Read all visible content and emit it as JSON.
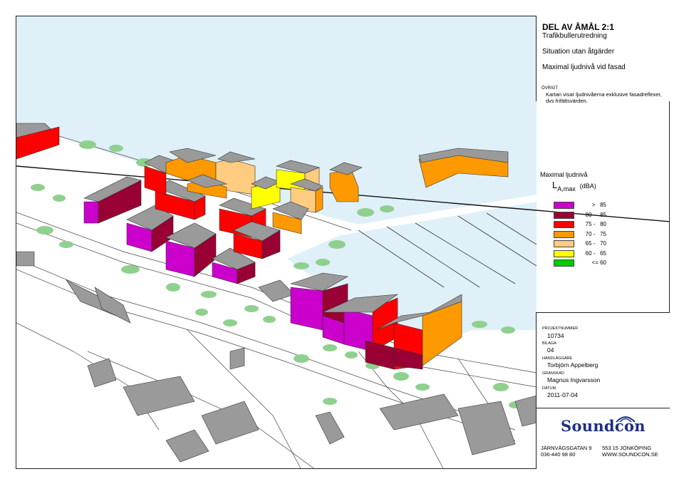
{
  "title": {
    "main": "DEL AV ÅMÅL 2:1",
    "subtitle": "Trafikbullerutredning",
    "situation": "Situation utan åtgärder",
    "measure": "Maximal ljudnivå vid fasad"
  },
  "ovrigt": {
    "label": "ÖVRIGT",
    "text_line1": "Kartan visar ljudnivåerna exklusive fasadreflexer,",
    "text_line2": "dvs frifältsvärden."
  },
  "legend": {
    "title": "Maximal ljudnivå",
    "unit_symbol": "L",
    "unit_sub": "A,max",
    "unit": "(dBA)",
    "items": [
      {
        "label": ">   85",
        "color": "#cc00cc"
      },
      {
        "label": "80 -   85",
        "color": "#990033"
      },
      {
        "label": "75 -   80",
        "color": "#ff0000"
      },
      {
        "label": "70 -   75",
        "color": "#ff9900"
      },
      {
        "label": "65 -   70",
        "color": "#ffcc80"
      },
      {
        "label": "60 -   65",
        "color": "#ffff00"
      },
      {
        "label": "<= 60",
        "color": "#00cc00"
      }
    ]
  },
  "info": {
    "projektnummer_label": "PROJEKTNUMMER",
    "projektnummer": "10734",
    "bilaga_label": "BILAGA",
    "bilaga": "04",
    "handlaggare_label": "HANDLÄGGARE",
    "handlaggare": "Torbjörn Appelberg",
    "granskad_label": "GRANSKAD",
    "granskad": "Magnus Ingvarsson",
    "datum_label": "DATUM",
    "datum": "2011-07-04"
  },
  "company": {
    "logo": "Soundcon",
    "address_left_1": "JÄRNVÄGSGATAN 9",
    "address_left_2": "036-440 98 80",
    "address_right_1": "553 15 JÖNKÖPING",
    "address_right_2": "WWW.SOUNDCON.SE"
  },
  "colors": {
    "water": "#dff0f8",
    "building_roof": "#9a9a9a",
    "tree": "#8fd08f",
    "frame": "#222222"
  }
}
